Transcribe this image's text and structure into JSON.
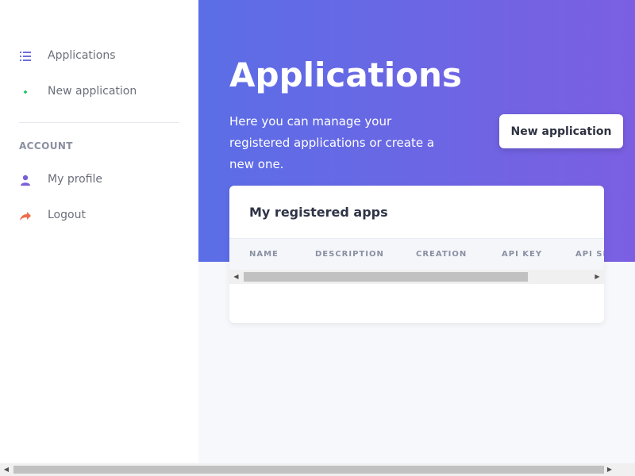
{
  "sidebar": {
    "items": [
      {
        "label": "Applications",
        "icon": "list-icon"
      },
      {
        "label": "New application",
        "icon": "plus-icon"
      }
    ],
    "section_heading": "ACCOUNT",
    "account_items": [
      {
        "label": "My profile",
        "icon": "user-icon"
      },
      {
        "label": "Logout",
        "icon": "share-arrow-icon"
      }
    ]
  },
  "header": {
    "title": "Applications",
    "subtitle": "Here you can manage your registered applications or create a new one.",
    "new_button_label": "New application"
  },
  "card": {
    "title": "My registered apps",
    "columns": [
      "NAME",
      "DESCRIPTION",
      "CREATION",
      "API KEY",
      "API SE"
    ]
  },
  "colors": {
    "gradient_start": "#5b6ee6",
    "gradient_end": "#7b5fe2",
    "icon_list": "#6c6fdc",
    "icon_plus": "#2ecc71",
    "icon_user": "#7a5fd6",
    "icon_logout": "#f06b4a"
  }
}
